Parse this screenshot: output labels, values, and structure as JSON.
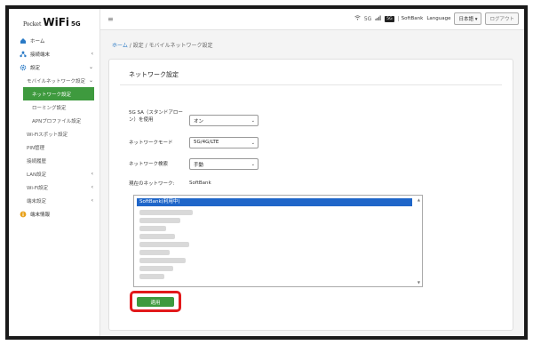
{
  "logo": {
    "pocket": "Pocket",
    "wifi": "WiFi",
    "g5": "5G"
  },
  "header": {
    "menu_icon": "hamburger-icon",
    "status_signal": "ᯤ",
    "status_label": "5G",
    "badge": "5G",
    "carrier": "SoftBank",
    "language_label": "Language",
    "language_value": "日本語 ▾",
    "logout_label": "ログアウト"
  },
  "sidebar": {
    "items": [
      {
        "label": "ホーム",
        "icon": "home-icon"
      },
      {
        "label": "接続端末",
        "icon": "devices-icon"
      },
      {
        "label": "設定",
        "icon": "gear-icon"
      },
      {
        "label": "モバイルネットワーク設定"
      },
      {
        "label": "ネットワーク設定"
      },
      {
        "label": "ローミング設定"
      },
      {
        "label": "APNプロファイル設定"
      },
      {
        "label": "Wi-Fiスポット設定"
      },
      {
        "label": "PIN管理"
      },
      {
        "label": "接続履歴"
      },
      {
        "label": "LAN設定"
      },
      {
        "label": "Wi-Fi設定"
      },
      {
        "label": "端末設定"
      },
      {
        "label": "端末情報",
        "icon": "info-icon"
      }
    ]
  },
  "breadcrumb": {
    "home": "ホーム",
    "sep1": " / ",
    "settings": "設定",
    "sep2": " / ",
    "current": "モバイルネットワーク設定"
  },
  "main": {
    "title": "ネットワーク設定",
    "sa_label": "5G SA（スタンドアロー ン）を使用",
    "sa_value": "オン",
    "mode_label": "ネットワークモード",
    "mode_value": "5G/4G/LTE",
    "search_label": "ネットワーク検索",
    "search_value": "手動",
    "current_label": "現在のネットワーク:",
    "current_value": "SoftBank",
    "list_selected": "SoftBank(利用中)",
    "apply_label": "適用"
  },
  "colors": {
    "accent_green": "#3e9a3e",
    "highlight_red": "#e2191b",
    "selection_blue": "#1f66c9",
    "link_blue": "#2a7ac6"
  }
}
